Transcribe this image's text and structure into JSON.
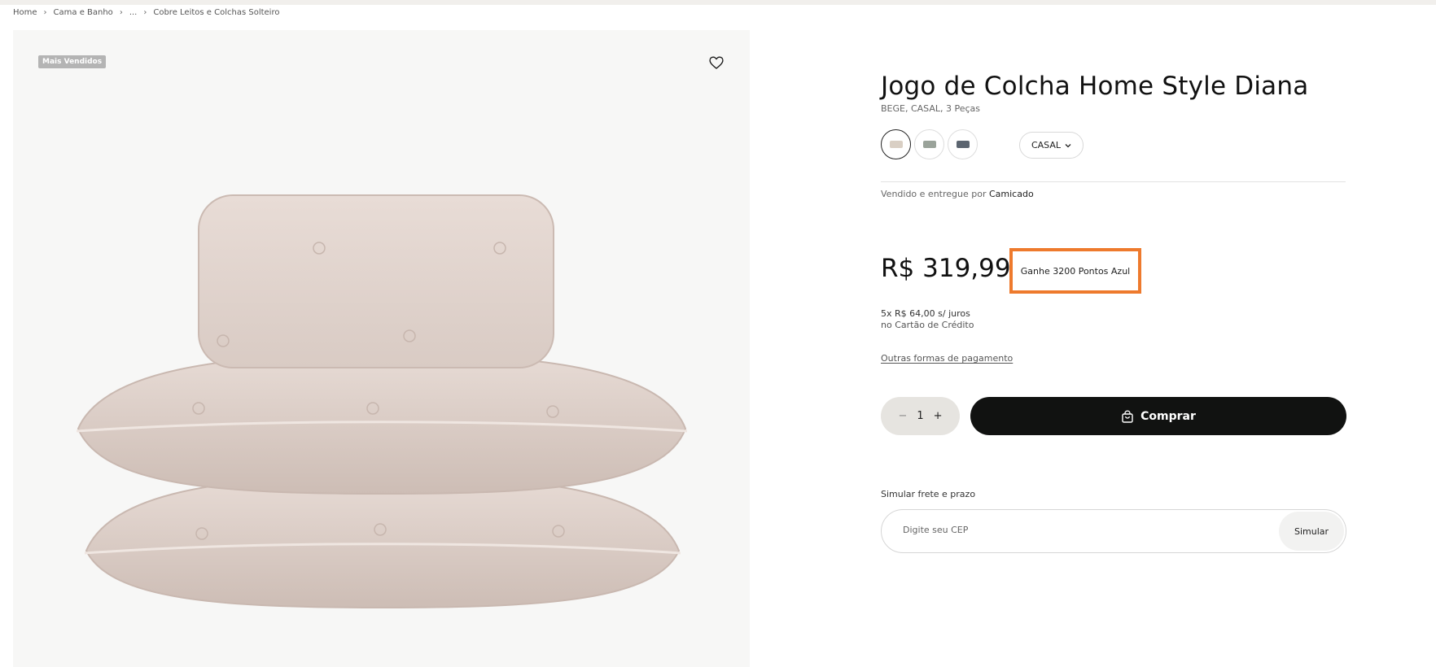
{
  "breadcrumb": {
    "items": [
      "Home",
      "Cama e Banho",
      "...",
      "Cobre Leitos e Colchas Solteiro"
    ]
  },
  "gallery": {
    "badge": "Mais Vendidos",
    "favorite_icon": "heart-icon",
    "image": "stacked-beige-bedspread-and-pillow-shams"
  },
  "product": {
    "title": "Jogo de Colcha Home Style Diana",
    "subtitle": "BEGE, CASAL, 3 Peças",
    "swatches": [
      {
        "color": "#d9cfc4",
        "selected": true
      },
      {
        "color": "#9aa39a",
        "selected": false
      },
      {
        "color": "#5c6570",
        "selected": false
      }
    ],
    "size_select": {
      "value": "CASAL",
      "icon": "chevron-down-icon"
    },
    "seller_prefix": "Vendido e entregue por",
    "seller_name": "Camicado",
    "price": "R$ 319,99",
    "points": "Ganhe 3200 Pontos Azul",
    "installment_line1": "5x R$ 64,00 s/ juros",
    "installment_line2": "no Cartão de Crédito",
    "other_payments": "Outras formas de pagamento",
    "quantity": "1",
    "buy_label": "Comprar",
    "buy_icon": "shopping-bag-icon"
  },
  "shipping": {
    "label": "Simular frete e prazo",
    "cep_placeholder": "Digite seu CEP",
    "simulate_label": "Simular"
  },
  "colors": {
    "accent_highlight": "#ee7a2d",
    "buy_button": "#111211",
    "qty_bg": "#e6e4e0"
  }
}
